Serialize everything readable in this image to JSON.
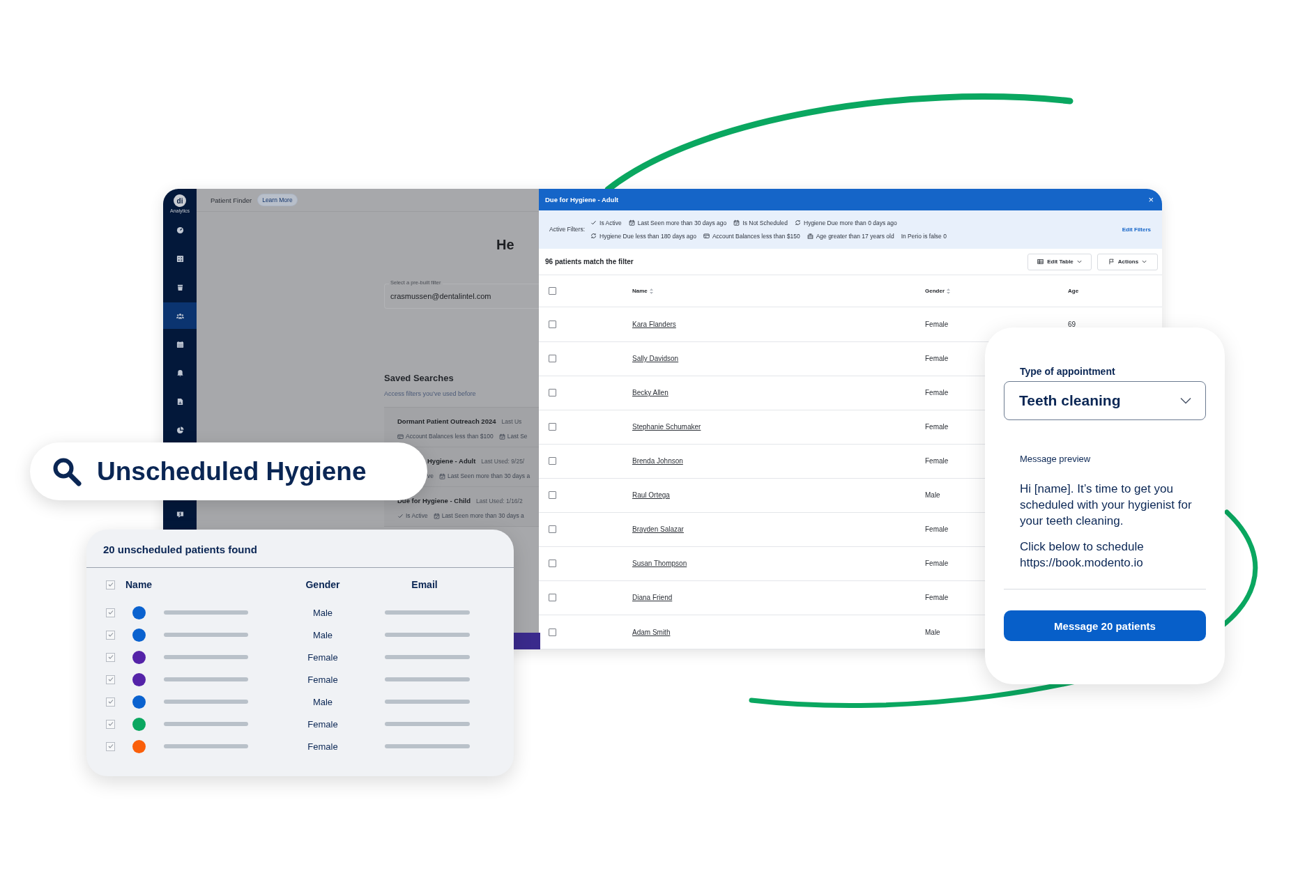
{
  "app": {
    "sidebar": {
      "logo": "di",
      "logo_caption": "Analytics",
      "items": [
        {
          "kind": "gauge",
          "selected": false
        },
        {
          "kind": "calculator",
          "selected": false
        },
        {
          "kind": "cup",
          "selected": false
        },
        {
          "kind": "people",
          "selected": true
        },
        {
          "kind": "calendar",
          "selected": false
        },
        {
          "kind": "bell",
          "selected": false
        },
        {
          "kind": "report",
          "selected": false
        },
        {
          "kind": "pie",
          "selected": false
        },
        {
          "kind": "chat",
          "selected": false
        }
      ]
    },
    "header": {
      "title": "Patient Finder",
      "link": "Learn More"
    },
    "heading": "He",
    "filter_field": {
      "label": "Select a pre-built filter",
      "value": "crasmussen@dentalintel.com"
    },
    "saved_searches": {
      "title": "Saved Searches",
      "subtitle": "Access filters you’ve used before",
      "items": [
        {
          "name": "Dormant Patient Outreach 2024",
          "last_used": "Last Us",
          "filters": [
            {
              "kind": "card",
              "text": "Account Balances less than $100"
            },
            {
              "kind": "calendar",
              "text": "Last Se"
            }
          ]
        },
        {
          "name": "Hygiene - Adult",
          "last_used": "Last Used: 9/25/",
          "filters": [
            {
              "kind": "none",
              "text": "ve"
            },
            {
              "kind": "calendar",
              "text": "Last Seen more than 30 days a"
            }
          ]
        },
        {
          "name": "Due for Hygiene - Child",
          "last_used": "Last Used: 1/16/2",
          "filters": [
            {
              "kind": "check",
              "text": "Is Active"
            },
            {
              "kind": "calendar",
              "text": "Last Seen more than 30 days a"
            }
          ]
        }
      ]
    }
  },
  "modal": {
    "title": "Due for Hygiene - Adult",
    "close": "×",
    "filters_label": "Active Filters:",
    "filter_rows": [
      [
        {
          "kind": "check",
          "text": "Is Active"
        },
        {
          "kind": "calendar",
          "text": "Last Seen more than 30 days ago"
        },
        {
          "kind": "calendar",
          "text": "Is Not Scheduled"
        },
        {
          "kind": "cycle",
          "text": "Hygiene Due more than 0 days ago"
        }
      ],
      [
        {
          "kind": "cycle",
          "text": "Hygiene Due less than 180 days ago"
        },
        {
          "kind": "card",
          "text": "Account Balances less than $150"
        },
        {
          "kind": "cake",
          "text": "Age greater than 17 years old"
        },
        {
          "kind": "none",
          "text": "In Perio is false 0"
        }
      ]
    ],
    "edit_filters": "Edit Filters",
    "match_count": "96 patients match the filter",
    "toolbar": [
      {
        "kind": "table",
        "label": "Edit Table"
      },
      {
        "kind": "flag",
        "label": "Actions"
      }
    ],
    "table": {
      "columns": [
        "Name",
        "Gender",
        "Age"
      ],
      "all_checked": false,
      "rows": [
        {
          "name": "Kara Flanders",
          "gender": "Female",
          "age": "69",
          "checked": false
        },
        {
          "name": "Sally Davidson",
          "gender": "Female",
          "checked": false
        },
        {
          "name": "Becky Allen",
          "gender": "Female",
          "checked": false
        },
        {
          "name": "Stephanie Schumaker",
          "gender": "Female",
          "checked": false
        },
        {
          "name": "Brenda Johnson",
          "gender": "Female",
          "checked": false
        },
        {
          "name": "Raul Ortega",
          "gender": "Male",
          "checked": false
        },
        {
          "name": "Brayden Salazar",
          "gender": "Female",
          "checked": false
        },
        {
          "name": "Susan Thompson",
          "gender": "Female",
          "checked": false
        },
        {
          "name": "Diana Friend",
          "gender": "Female",
          "checked": false
        },
        {
          "name": "Adam Smith",
          "gender": "Male",
          "checked": false
        }
      ]
    }
  },
  "search_pill": {
    "text": "Unscheduled Hygiene"
  },
  "results_card": {
    "title": "20 unscheduled patients found",
    "all_checked": true,
    "columns": [
      "Name",
      "Gender",
      "Email"
    ],
    "rows": [
      {
        "checked": true,
        "color": "#0a62cf",
        "gender": "Male"
      },
      {
        "checked": true,
        "color": "#0a62cf",
        "gender": "Male"
      },
      {
        "checked": true,
        "color": "#5423a8",
        "gender": "Female"
      },
      {
        "checked": true,
        "color": "#5423a8",
        "gender": "Female"
      },
      {
        "checked": true,
        "color": "#0a62cf",
        "gender": "Male"
      },
      {
        "checked": true,
        "color": "#0aa760",
        "gender": "Female"
      },
      {
        "checked": true,
        "color": "#fa5f0a",
        "gender": "Female"
      }
    ]
  },
  "message_card": {
    "type_label": "Type of appointment",
    "appointment": "Teeth cleaning",
    "preview_label": "Message preview",
    "paragraphs": [
      "Hi [name]. It’s time to get you scheduled with your hygienist for your teeth cleaning.",
      "Click below to schedule\nhttps://book.modento.io"
    ],
    "button": "Message 20 patients"
  }
}
